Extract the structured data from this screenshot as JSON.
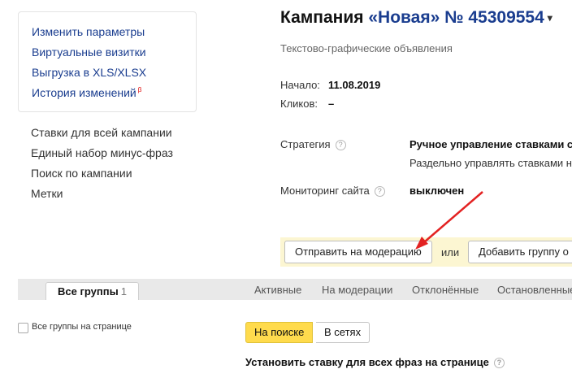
{
  "sidebar": {
    "card_links": [
      {
        "label": "Изменить параметры"
      },
      {
        "label": "Виртуальные визитки"
      },
      {
        "label": "Выгрузка в XLS/XLSX"
      },
      {
        "label": "История изменений",
        "badge": "β"
      }
    ],
    "links": [
      {
        "label": "Ставки для всей кампании"
      },
      {
        "label": "Единый набор минус-фраз"
      },
      {
        "label": "Поиск по кампании"
      },
      {
        "label": "Метки"
      }
    ]
  },
  "campaign": {
    "title_prefix": "Кампания",
    "name": "«Новая»",
    "number": "№ 45309554",
    "caret": "▾",
    "subtitle": "Текстово-графические объявления",
    "start_label": "Начало:",
    "start_value": "11.08.2019",
    "clicks_label": "Кликов:",
    "clicks_value": "–",
    "strategy_label": "Стратегия",
    "strategy_value": "Ручное управление ставками с о",
    "strategy_desc": "Раздельно управлять ставками н",
    "monitoring_label": "Мониторинг сайта",
    "monitoring_value": "выключен",
    "help_glyph": "?"
  },
  "actions": {
    "moderation_button": "Отправить на модерацию",
    "or_text": "или",
    "add_group_button": "Добавить группу о"
  },
  "tabs": {
    "active_label": "Все группы",
    "active_count": "1",
    "items": [
      "Активные",
      "На модерации",
      "Отклонённые",
      "Остановленные"
    ]
  },
  "groups": {
    "all_on_page_label": "Все группы на странице",
    "segment_search": "На поиске",
    "segment_networks": "В сетях",
    "set_rate_label": "Установить ставку для всех фраз на странице"
  },
  "colors": {
    "link": "#1a3d8f",
    "action_bar_bg": "#fcf6d2",
    "segment_active": "#ffdb4d",
    "arrow": "#e32222"
  }
}
